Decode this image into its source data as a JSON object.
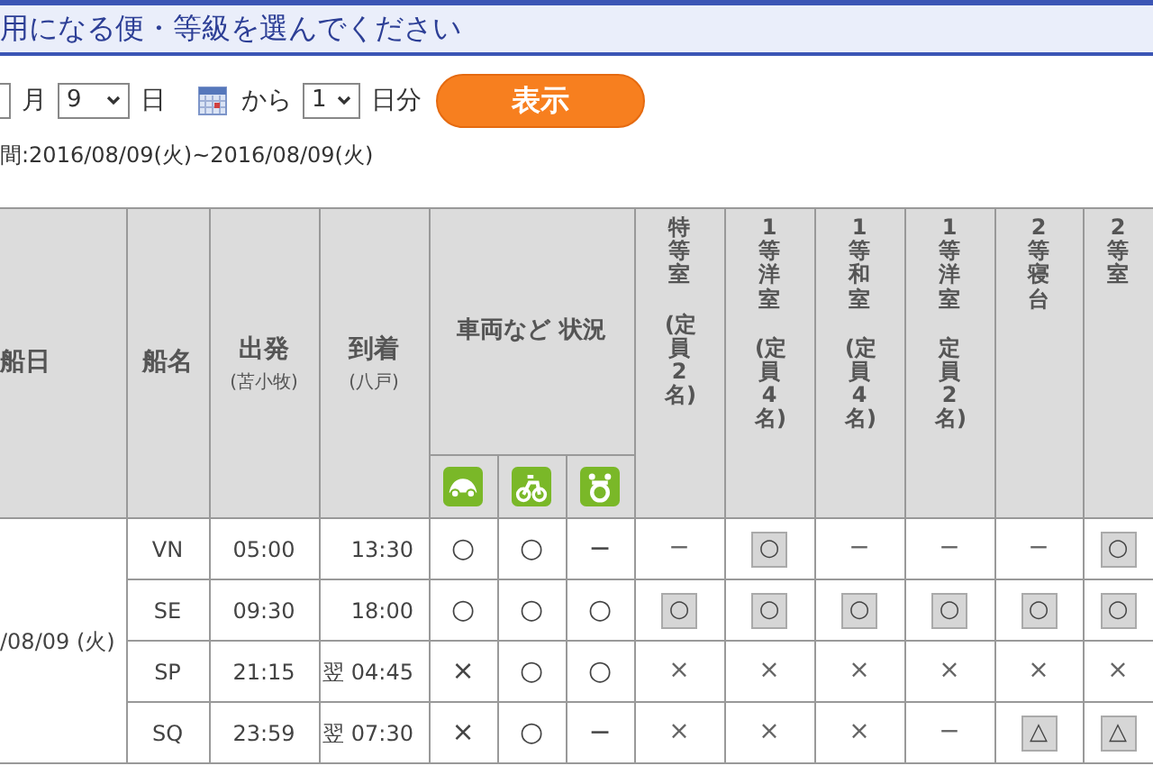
{
  "title": "用になる便・等級を選んでください",
  "form": {
    "month_label": "月",
    "day_value": "9",
    "day_label": "日",
    "from_label": "から",
    "days_value": "1",
    "days_label": "日分",
    "submit": "表示"
  },
  "period": "間:2016/08/09(火)~2016/08/09(火)",
  "table": {
    "date_header": "船日",
    "ship_header": "船名",
    "depart_header": "出発",
    "depart_port": "(苫小牧)",
    "arrive_header": "到着",
    "arrive_port": "(八戸)",
    "vehicle_header": "車両など 状況",
    "vehicle_icons": [
      {
        "kind": "car"
      },
      {
        "kind": "motorcycle"
      },
      {
        "kind": "pet"
      }
    ],
    "classes": [
      {
        "name": "特等室",
        "capacity": "(定員2名)"
      },
      {
        "name": "1等洋室",
        "capacity": "(定員4名)"
      },
      {
        "name": "1等和室",
        "capacity": "(定員4名)"
      },
      {
        "name": "1等洋室",
        "capacity": "定員2名)"
      },
      {
        "name": "2等寝台"
      },
      {
        "name": "2等室"
      }
    ],
    "date": "/08/09 (火)",
    "rows": [
      {
        "ship": "VN",
        "depart": "05:00",
        "arrive": "13:30",
        "vehicles": [
          "○",
          "○",
          "−"
        ],
        "cells": [
          {
            "text": "−",
            "link": false
          },
          {
            "text": "○",
            "link": true
          },
          {
            "text": "−",
            "link": false
          },
          {
            "text": "−",
            "link": false
          },
          {
            "text": "−",
            "link": false
          },
          {
            "text": "○",
            "link": true
          }
        ]
      },
      {
        "ship": "SE",
        "depart": "09:30",
        "arrive": "18:00",
        "vehicles": [
          "○",
          "○",
          "○"
        ],
        "cells": [
          {
            "text": "○",
            "link": true
          },
          {
            "text": "○",
            "link": true
          },
          {
            "text": "○",
            "link": true
          },
          {
            "text": "○",
            "link": true
          },
          {
            "text": "○",
            "link": true
          },
          {
            "text": "○",
            "link": true
          }
        ]
      },
      {
        "ship": "SP",
        "depart": "21:15",
        "next_day_mark": "翌",
        "arrive": "04:45",
        "vehicles": [
          "×",
          "○",
          "○"
        ],
        "cells": [
          {
            "text": "×",
            "link": false
          },
          {
            "text": "×",
            "link": false
          },
          {
            "text": "×",
            "link": false
          },
          {
            "text": "×",
            "link": false
          },
          {
            "text": "×",
            "link": false
          },
          {
            "text": "×",
            "link": false
          }
        ]
      },
      {
        "ship": "SQ",
        "depart": "23:59",
        "next_day_mark": "翌",
        "arrive": "07:30",
        "vehicles": [
          "×",
          "○",
          "−"
        ],
        "cells": [
          {
            "text": "×",
            "link": false
          },
          {
            "text": "×",
            "link": false
          },
          {
            "text": "×",
            "link": false
          },
          {
            "text": "−",
            "link": false
          },
          {
            "text": "△",
            "link": true
          },
          {
            "text": "△",
            "link": true
          }
        ]
      }
    ]
  }
}
